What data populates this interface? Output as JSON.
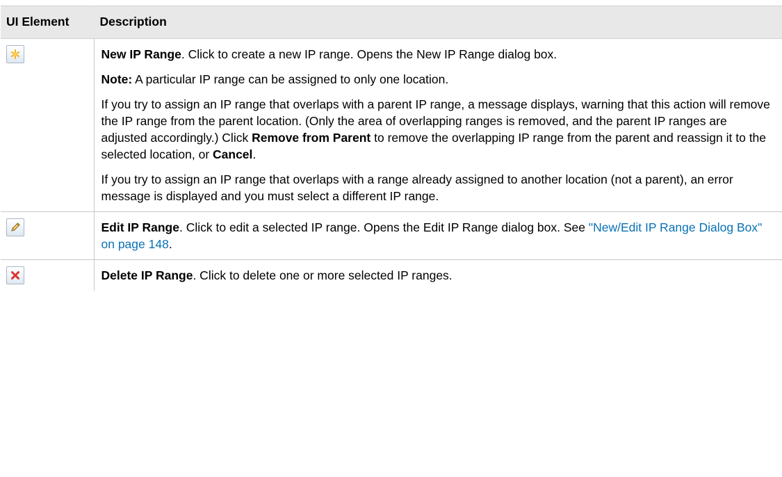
{
  "table": {
    "header": {
      "col1": "UI Element",
      "col2": "Description"
    },
    "rows": [
      {
        "icon": "new-star-icon",
        "paragraphs": {
          "p1": {
            "term": "New IP Range",
            "text": ". Click to create a new IP range. Opens the New IP Range dialog box."
          },
          "p2": {
            "label": "Note:",
            "text": " A particular IP range can be assigned to only one location."
          },
          "p3": {
            "text_a": "If you try to assign an IP range that overlaps with a parent IP range, a message displays, warning that this action will remove the IP range from the parent location. (Only the area of overlapping ranges is removed, and the parent IP ranges are adjusted accordingly.) Click ",
            "bold_a": "Remove from Parent",
            "text_b": " to remove the overlapping IP range from the parent and reassign it to the selected location, or ",
            "bold_b": "Cancel",
            "text_c": "."
          },
          "p4": {
            "text": "If you try to assign an IP range that overlaps with a range already assigned to another location (not a parent), an error message is displayed and you must select a different IP range."
          }
        }
      },
      {
        "icon": "pencil-icon",
        "paragraphs": {
          "p1": {
            "term": "Edit IP Range",
            "text": ". Click to edit a selected IP range. Opens the Edit IP Range dialog box. See ",
            "link": "\"New/Edit IP Range Dialog Box\" on page 148",
            "end": "."
          }
        }
      },
      {
        "icon": "red-x-icon",
        "paragraphs": {
          "p1": {
            "term": "Delete IP Range",
            "text": ". Click to delete one or more selected IP ranges."
          }
        }
      }
    ]
  },
  "colors": {
    "header_bg": "#e8e8e8",
    "link": "#0a72b5",
    "delete_icon": "#d9342b",
    "new_icon": "#f3b21a"
  }
}
